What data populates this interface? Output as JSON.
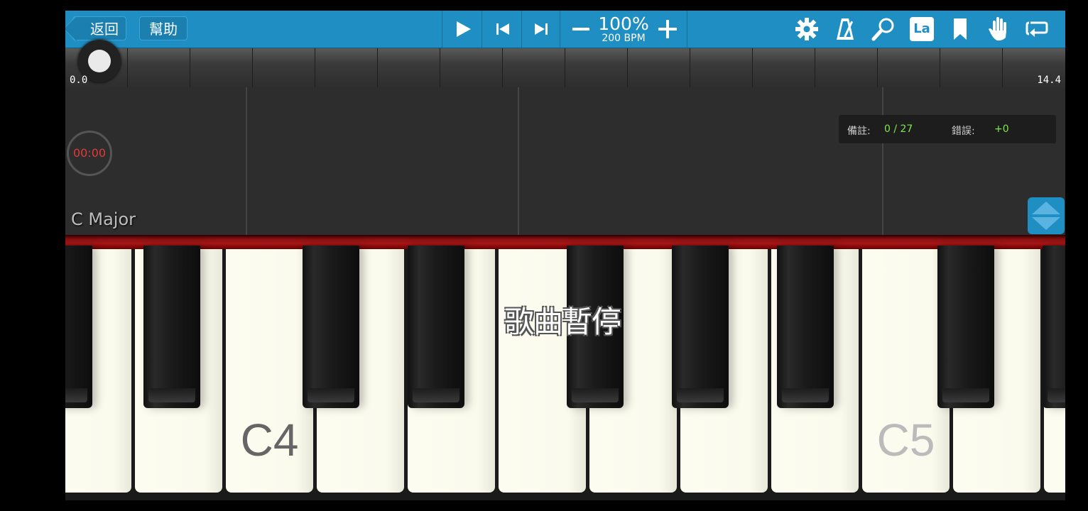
{
  "toolbar": {
    "back_label": "返回",
    "help_label": "幫助",
    "zoom_percent": "100%",
    "tempo": "200 BPM",
    "icons": [
      "play-icon",
      "skip-back-icon",
      "skip-forward-icon",
      "minus-icon",
      "plus-icon",
      "gear-icon",
      "metronome-icon",
      "magnifier-icon",
      "la-icon",
      "bookmark-icon",
      "hand-icon",
      "loop-icon"
    ],
    "la_label": "La",
    "accent_color": "#1f8ec3"
  },
  "timeline": {
    "start": "0.0",
    "end": "14.4"
  },
  "score": {
    "timer": "00:00",
    "notes_label": "備註:",
    "notes_value": "0 / 27",
    "errors_label": "錯誤:",
    "errors_value": "+0",
    "key_signature": "C Major"
  },
  "keyboard": {
    "status": "歌曲暫停",
    "labels": [
      "C4",
      "C5"
    ]
  }
}
